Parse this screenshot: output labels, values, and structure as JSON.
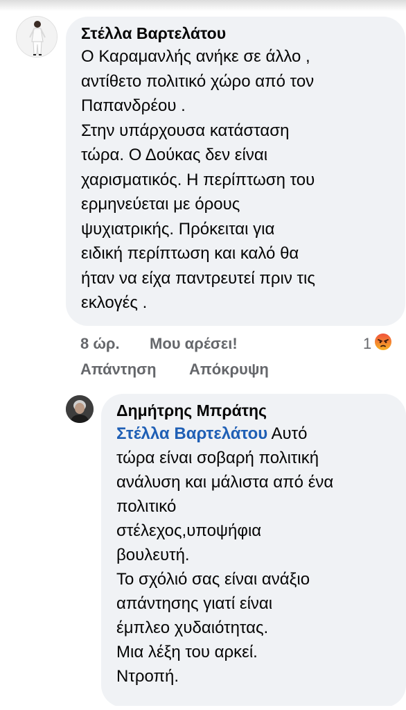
{
  "comment": {
    "author": "Στέλλα Βαρτελάτου",
    "text": "Ο Καραμανλής ανήκε σε άλλο ,\nαντίθετο πολιτικό χώρο από τον\nΠαπανδρέου .\nΣτην υπάρχουσα  κατάσταση\nτώρα. Ο Δούκας δεν είναι\nχαρισματικός. Η περίπτωση του\nερμηνεύεται με όρους\nψυχιατρικής. Πρόκειται για\nειδική περίπτωση και καλό θα\nήταν να είχα παντρευτεί πριν τις\nεκλογές .",
    "time": "8 ώρ.",
    "like_label": "Μου αρέσει!",
    "reply_label": "Απάντηση",
    "hide_label": "Απόκρυψη",
    "reaction_count": "1",
    "reaction_icon": "angry-emoji-icon"
  },
  "reply": {
    "author": "Δημήτρης Μπράτης",
    "mention": "Στέλλα Βαρτελάτου",
    "text": " Αυτό\nτώρα είναι σοβαρή πολιτική\nανάλυση και μάλιστα από ένα\nπολιτικό\nστέλεχος,υποψήφια\nβουλευτή.\nΤο σχόλιό σας είναι ανάξιο\nαπάντησης γιατί είναι\nέμπλεο χυδαιότητας.\nΜια λέξη του αρκεί.\nΝτροπή."
  },
  "colors": {
    "bubble_background": "#f0f2f5",
    "mention": "#1f5fb5",
    "secondary_text": "#65676b",
    "angry_reaction": "#f0533d"
  }
}
